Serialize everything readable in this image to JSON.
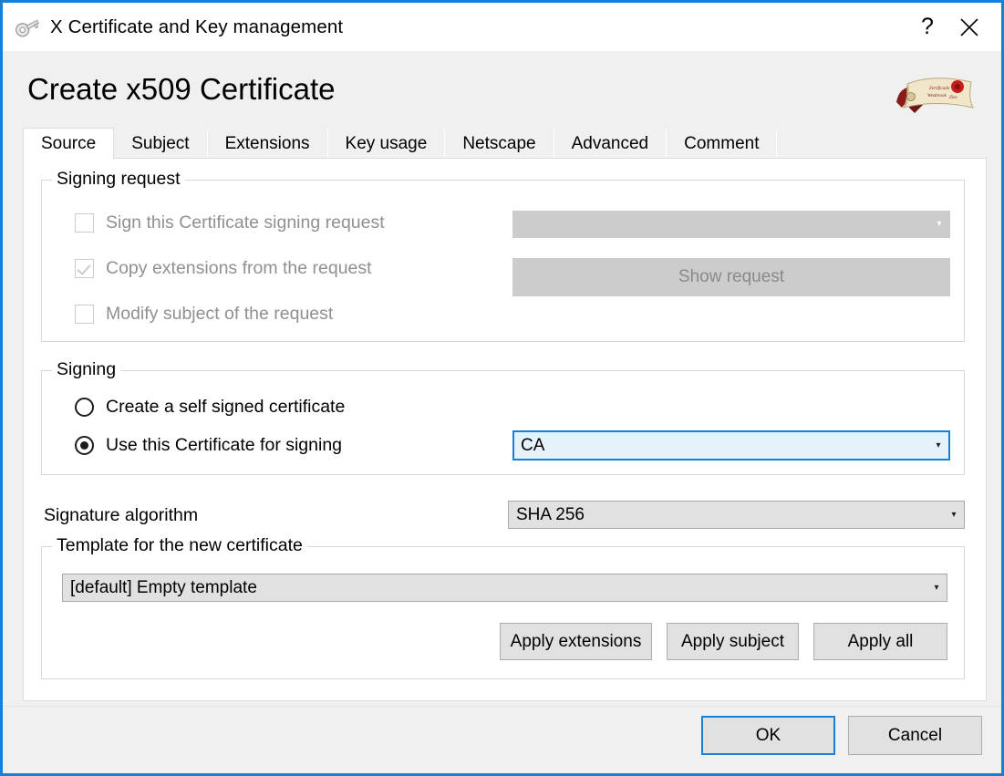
{
  "window": {
    "title": "X Certificate and Key management",
    "icon": "key-icon",
    "help_label": "?",
    "close_label": "✕",
    "accent_color": "#1580d6",
    "background_color": "#f0f0f0"
  },
  "heading": "Create x509 Certificate",
  "tabs": [
    {
      "label": "Source",
      "active": true
    },
    {
      "label": "Subject",
      "active": false
    },
    {
      "label": "Extensions",
      "active": false
    },
    {
      "label": "Key usage",
      "active": false
    },
    {
      "label": "Netscape",
      "active": false
    },
    {
      "label": "Advanced",
      "active": false
    },
    {
      "label": "Comment",
      "active": false
    }
  ],
  "signing_request": {
    "group_title": "Signing request",
    "sign_csr": {
      "label": "Sign this Certificate signing request",
      "checked": false,
      "enabled": false
    },
    "copy_extensions": {
      "label": "Copy extensions from the request",
      "checked": true,
      "enabled": false
    },
    "modify_subject": {
      "label": "Modify subject of the request",
      "checked": false,
      "enabled": false
    },
    "request_combo": {
      "value": "",
      "enabled": false,
      "arrow": "▾"
    },
    "show_request_button": {
      "label": "Show request",
      "enabled": false
    }
  },
  "signing": {
    "group_title": "Signing",
    "self_signed": {
      "label": "Create a self signed certificate",
      "selected": false
    },
    "use_certificate": {
      "label": "Use this Certificate for signing",
      "selected": true
    },
    "certificate_combo": {
      "value": "CA",
      "focused": true,
      "arrow": "▾"
    }
  },
  "signature_algorithm": {
    "label": "Signature algorithm",
    "value": "SHA 256",
    "arrow": "▾"
  },
  "template": {
    "group_title": "Template for the new certificate",
    "value": "[default] Empty template",
    "arrow": "▾",
    "buttons": [
      {
        "label": "Apply extensions"
      },
      {
        "label": "Apply subject"
      },
      {
        "label": "Apply all"
      }
    ]
  },
  "dialog_buttons": {
    "ok": "OK",
    "cancel": "Cancel"
  }
}
